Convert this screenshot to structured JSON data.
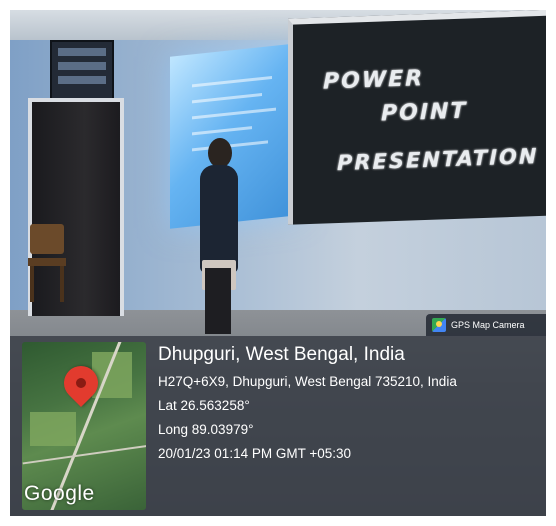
{
  "blackboard": {
    "line1": "POWER",
    "line2": "POINT",
    "line3": "PRESENTATION"
  },
  "gps_tag": {
    "icon": "gps-map-camera-logo-icon",
    "label": "GPS Map Camera"
  },
  "location": {
    "title": "Dhupguri, West Bengal, India",
    "address": "H27Q+6X9, Dhupguri, West Bengal 735210, India",
    "latitude": "Lat 26.563258°",
    "longitude": "Long 89.03979°",
    "datetime": "20/01/23 01:14 PM GMT +05:30"
  },
  "map": {
    "attribution": "Google",
    "pin_color": "#e23b2e"
  }
}
